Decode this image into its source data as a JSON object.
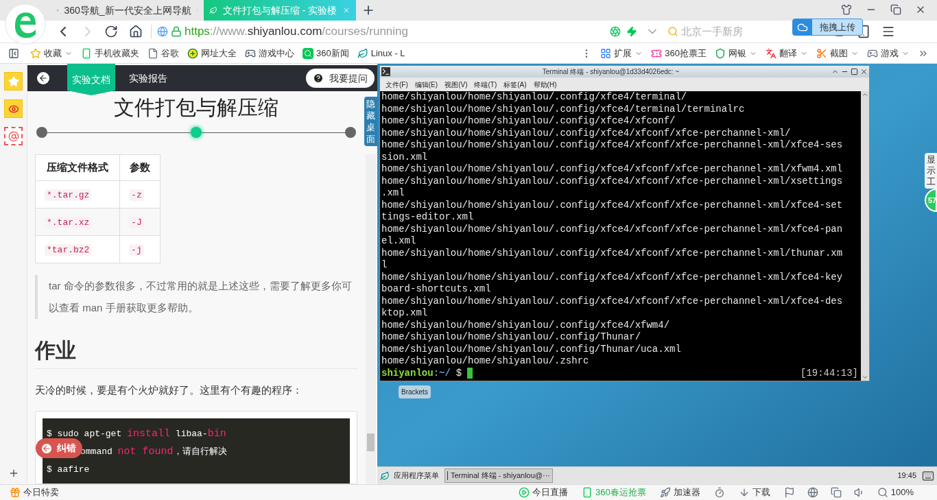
{
  "browser": {
    "tabs": [
      {
        "title": "360导航_新一代安全上网导航",
        "selected": false
      },
      {
        "title": "文件打包与解压缩 - 实验楼",
        "selected": true
      }
    ],
    "url_parts": [
      {
        "kind": "scheme",
        "text": "https"
      },
      {
        "kind": "muted",
        "text": "://www."
      },
      {
        "kind": "domain",
        "text": "shiyanlou.com"
      },
      {
        "kind": "muted",
        "text": "/courses/running"
      }
    ],
    "search": {
      "placeholder": "北京一手新房"
    },
    "upload_tooltip": "拖拽上传",
    "bookmarks": [
      {
        "label": "收藏",
        "dropdown": true
      },
      {
        "label": "手机收藏夹",
        "dropdown": false
      },
      {
        "label": "谷歌",
        "dropdown": false
      },
      {
        "label": "网址大全",
        "dropdown": false
      },
      {
        "label": "游戏中心",
        "dropdown": false
      },
      {
        "label": "360新闻",
        "dropdown": false
      },
      {
        "label": "Linux - L",
        "dropdown": false
      }
    ],
    "extensions": [
      {
        "label": "扩展",
        "dropdown": true
      },
      {
        "label": "360抢票王",
        "dropdown": false
      },
      {
        "label": "网银",
        "dropdown": true
      },
      {
        "label": "翻译",
        "dropdown": true
      },
      {
        "label": "截图",
        "dropdown": true
      },
      {
        "label": "游戏",
        "dropdown": true
      }
    ]
  },
  "doc": {
    "tabs": [
      {
        "label": "实验文档",
        "selected": true
      },
      {
        "label": "实验报告",
        "selected": false
      }
    ],
    "ask_button": "我要提问",
    "title": "文件打包与解压缩",
    "steps": [
      {
        "selected": false
      },
      {
        "selected": true
      },
      {
        "selected": false
      }
    ],
    "hide_desktop": "隐藏桌面",
    "table": {
      "columns": [
        "压缩文件格式",
        "参数"
      ],
      "rows": [
        [
          "*.tar.gz",
          "-z"
        ],
        [
          "*.tar.xz",
          "-J"
        ],
        [
          "*tar.bz2",
          "-j"
        ]
      ]
    },
    "note": "tar 命令的参数很多，不过常用的就是上述这些，需要了解更多你可以查看 man 手册获取更多帮助。",
    "heading": "作业",
    "paragraph": "天冷的时候，要是有个火炉就好了。这里有个有趣的程序：",
    "code_lines": [
      [
        {
          "kind": "plain",
          "text": "$ sudo apt-get "
        },
        {
          "kind": "keyword",
          "text": "install"
        },
        {
          "kind": "plain",
          "text": " libaa-"
        },
        {
          "kind": "keyword",
          "text": "bin"
        }
      ],
      [
        {
          "kind": "plain",
          "text": "ommand "
        },
        {
          "kind": "keyword",
          "text": "not found"
        },
        {
          "kind": "plain",
          "text": "，请自行解决"
        }
      ],
      [
        {
          "kind": "plain",
          "text": "$ aafire"
        }
      ]
    ],
    "fix_button": "纠错"
  },
  "terminal": {
    "title": "Terminal 终端 - shiyanlou@1d33d4026edc: ~",
    "menu": [
      "文件(F)",
      "编辑(E)",
      "视图(V)",
      "终端(T)",
      "标签(A)",
      "帮助(H)"
    ],
    "lines": [
      "home/shiyanlou/home/shiyanlou/.config/xfce4/terminal/",
      "home/shiyanlou/home/shiyanlou/.config/xfce4/terminal/terminalrc",
      "home/shiyanlou/home/shiyanlou/.config/xfce4/xfconf/",
      "home/shiyanlou/home/shiyanlou/.config/xfce4/xfconf/xfce-perchannel-xml/",
      "home/shiyanlou/home/shiyanlou/.config/xfce4/xfconf/xfce-perchannel-xml/xfce4-ses",
      "sion.xml",
      "home/shiyanlou/home/shiyanlou/.config/xfce4/xfconf/xfce-perchannel-xml/xfwm4.xml",
      "home/shiyanlou/home/shiyanlou/.config/xfce4/xfconf/xfce-perchannel-xml/xsettings",
      ".xml",
      "home/shiyanlou/home/shiyanlou/.config/xfce4/xfconf/xfce-perchannel-xml/xfce4-set",
      "tings-editor.xml",
      "home/shiyanlou/home/shiyanlou/.config/xfce4/xfconf/xfce-perchannel-xml/xfce4-pan",
      "el.xml",
      "home/shiyanlou/home/shiyanlou/.config/xfce4/xfconf/xfce-perchannel-xml/thunar.xm",
      "l",
      "home/shiyanlou/home/shiyanlou/.config/xfce4/xfconf/xfce-perchannel-xml/xfce4-key",
      "board-shortcuts.xml",
      "home/shiyanlou/home/shiyanlou/.config/xfce4/xfconf/xfce-perchannel-xml/xfce4-des",
      "ktop.xml",
      "home/shiyanlou/home/shiyanlou/.config/xfce4/xfwm4/",
      "home/shiyanlou/home/shiyanlou/.config/Thunar/",
      "home/shiyanlou/home/shiyanlou/.config/Thunar/uca.xml",
      "home/shiyanlou/home/shiyanlou/.zshrc"
    ],
    "prompt": {
      "user": "shiyanlou",
      "path": ":~/",
      "symbol": "$"
    },
    "time": "[19:44:13]"
  },
  "desktop": {
    "icons": [
      {
        "label": "Brackets"
      }
    ],
    "taskbar": {
      "menu": "应用程序菜单",
      "windows": [
        {
          "title": "Terminal 终端 - shiyanlou@···",
          "selected": true
        }
      ],
      "clock": "19:45"
    },
    "side_tab": "显示工",
    "badge": "57"
  },
  "status_bar": {
    "left": "今日特卖",
    "items": [
      {
        "kind": "live",
        "label": "今日直播"
      },
      {
        "kind": "promo",
        "label": "360春运抢票"
      },
      {
        "kind": "speed",
        "label": "加速器"
      },
      {
        "kind": "download",
        "label": "下载"
      },
      {
        "kind": "zoom",
        "label": "100%"
      }
    ]
  }
}
